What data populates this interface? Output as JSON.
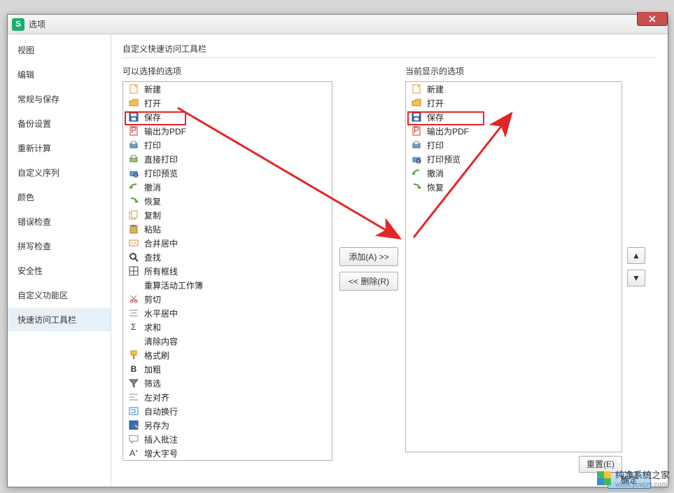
{
  "window": {
    "title": "选项"
  },
  "sidebar": {
    "items": [
      {
        "label": "视图"
      },
      {
        "label": "编辑"
      },
      {
        "label": "常规与保存"
      },
      {
        "label": "备份设置"
      },
      {
        "label": "重新计算"
      },
      {
        "label": "自定义序列"
      },
      {
        "label": "颜色"
      },
      {
        "label": "错误检查"
      },
      {
        "label": "拼写检查"
      },
      {
        "label": "安全性"
      },
      {
        "label": "自定义功能区"
      },
      {
        "label": "快速访问工具栏"
      }
    ],
    "active_index": 11
  },
  "section": {
    "title": "自定义快速访问工具栏",
    "left_label": "可以选择的选项",
    "right_label": "当前显示的选项"
  },
  "buttons": {
    "add": "添加(A) >>",
    "remove": "<< 删除(R)",
    "reset": "重置(E)",
    "ok": "确定",
    "up": "▲",
    "down": "▼"
  },
  "left_list": [
    {
      "icon": "new",
      "label": "新建"
    },
    {
      "icon": "open",
      "label": "打开"
    },
    {
      "icon": "save",
      "label": "保存",
      "highlight": true
    },
    {
      "icon": "pdf",
      "label": "输出为PDF"
    },
    {
      "icon": "print",
      "label": "打印"
    },
    {
      "icon": "print-direct",
      "label": "直接打印"
    },
    {
      "icon": "print-preview",
      "label": "打印预览"
    },
    {
      "icon": "undo",
      "label": "撤消"
    },
    {
      "icon": "redo",
      "label": "恢复"
    },
    {
      "icon": "copy",
      "label": "复制"
    },
    {
      "icon": "paste",
      "label": "粘贴"
    },
    {
      "icon": "merge",
      "label": "合并居中"
    },
    {
      "icon": "find",
      "label": "查找"
    },
    {
      "icon": "borders",
      "label": "所有框线"
    },
    {
      "icon": "",
      "label": "重算活动工作簿",
      "group": true
    },
    {
      "icon": "cut",
      "label": "剪切"
    },
    {
      "icon": "center-h",
      "label": "水平居中"
    },
    {
      "icon": "sum",
      "label": "求和"
    },
    {
      "icon": "",
      "label": "清除内容",
      "group": true
    },
    {
      "icon": "format-painter",
      "label": "格式刷"
    },
    {
      "icon": "bold",
      "label": "加粗"
    },
    {
      "icon": "filter",
      "label": "筛选"
    },
    {
      "icon": "align-left",
      "label": "左对齐"
    },
    {
      "icon": "wrap",
      "label": "自动换行"
    },
    {
      "icon": "save-as",
      "label": "另存为"
    },
    {
      "icon": "comment",
      "label": "插入批注"
    },
    {
      "icon": "font-grow",
      "label": "增大字号"
    }
  ],
  "right_list": [
    {
      "icon": "new",
      "label": "新建"
    },
    {
      "icon": "open",
      "label": "打开"
    },
    {
      "icon": "save",
      "label": "保存",
      "highlight": true
    },
    {
      "icon": "pdf",
      "label": "输出为PDF"
    },
    {
      "icon": "print",
      "label": "打印"
    },
    {
      "icon": "print-preview",
      "label": "打印预览"
    },
    {
      "icon": "undo",
      "label": "撤消"
    },
    {
      "icon": "redo",
      "label": "恢复"
    }
  ],
  "watermark": {
    "text": "纯净系统之家",
    "url": "www.ycwjzy.com"
  }
}
